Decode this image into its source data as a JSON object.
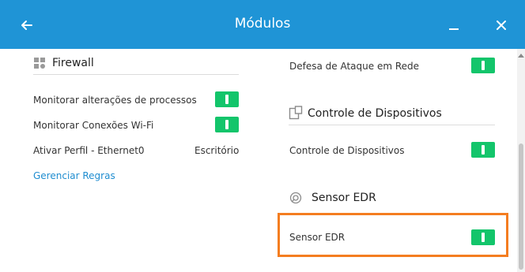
{
  "window": {
    "title": "Módulos"
  },
  "icons": {
    "back": "arrow-left-icon",
    "minimize": "minimize-icon",
    "close": "close-icon",
    "firewall": "firewall-grid-icon",
    "device_control": "device-control-icon",
    "edr": "edr-sensor-icon"
  },
  "colors": {
    "titlebar": "#1f94d6",
    "toggle_on": "#13c56b",
    "highlight": "#f47d20",
    "link": "#1f8dd0"
  },
  "left": {
    "section_title": "Firewall",
    "rows": [
      {
        "label": "Monitorar alterações de processos",
        "toggle": true
      },
      {
        "label": "Monitorar Conexões Wi-Fi",
        "toggle": true
      }
    ],
    "profile": {
      "label": "Ativar Perfil - Ethernet0",
      "value": "Escritório"
    },
    "manage_link": "Gerenciar Regras"
  },
  "right": {
    "network_attack": {
      "label": "Defesa de Ataque em Rede",
      "toggle": true
    },
    "device_section": {
      "title": "Controle de Dispositivos",
      "row": {
        "label": "Controle de Dispositivos",
        "toggle": true
      }
    },
    "edr_section": {
      "title": "Sensor EDR",
      "row": {
        "label": "Sensor EDR",
        "toggle": true
      }
    }
  }
}
